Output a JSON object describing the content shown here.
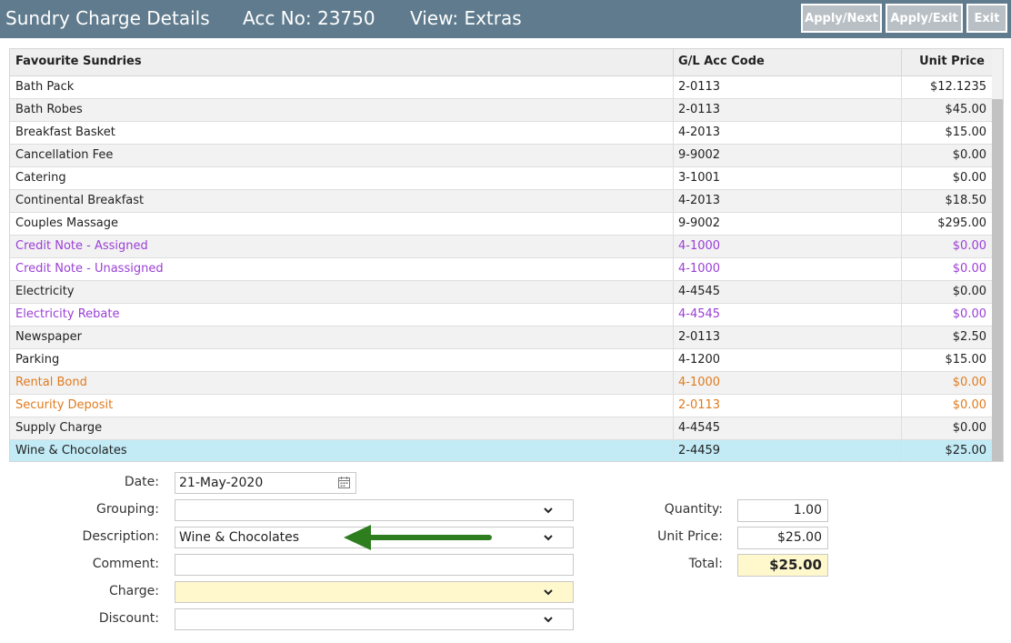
{
  "header": {
    "title": "Sundry Charge Details",
    "acc_no": "Acc No: 23750",
    "view": "View: Extras",
    "buttons": {
      "apply_next": "Apply/Next",
      "apply_exit": "Apply/Exit",
      "exit": "Exit"
    },
    "bg_color": "#5f7b8d"
  },
  "grid": {
    "columns": {
      "name": "Favourite Sundries",
      "gl": "G/L Acc Code",
      "price": "Unit Price"
    },
    "rows": [
      {
        "name": "Bath Pack",
        "gl": "2-0113",
        "price": "$12.1235",
        "style": ""
      },
      {
        "name": "Bath Robes",
        "gl": "2-0113",
        "price": "$45.00",
        "style": ""
      },
      {
        "name": "Breakfast Basket",
        "gl": "4-2013",
        "price": "$15.00",
        "style": ""
      },
      {
        "name": "Cancellation Fee",
        "gl": "9-9002",
        "price": "$0.00",
        "style": ""
      },
      {
        "name": "Catering",
        "gl": "3-1001",
        "price": "$0.00",
        "style": ""
      },
      {
        "name": "Continental Breakfast",
        "gl": "4-2013",
        "price": "$18.50",
        "style": ""
      },
      {
        "name": "Couples Massage",
        "gl": "9-9002",
        "price": "$295.00",
        "style": ""
      },
      {
        "name": "Credit Note - Assigned",
        "gl": "4-1000",
        "price": "$0.00",
        "style": "purple"
      },
      {
        "name": "Credit Note - Unassigned",
        "gl": "4-1000",
        "price": "$0.00",
        "style": "purple"
      },
      {
        "name": "Electricity",
        "gl": "4-4545",
        "price": "$0.00",
        "style": ""
      },
      {
        "name": "Electricity Rebate",
        "gl": "4-4545",
        "price": "$0.00",
        "style": "purple"
      },
      {
        "name": "Newspaper",
        "gl": "2-0113",
        "price": "$2.50",
        "style": ""
      },
      {
        "name": "Parking",
        "gl": "4-1200",
        "price": "$15.00",
        "style": ""
      },
      {
        "name": "Rental Bond",
        "gl": "4-1000",
        "price": "$0.00",
        "style": "orange"
      },
      {
        "name": "Security Deposit",
        "gl": "2-0113",
        "price": "$0.00",
        "style": "orange"
      },
      {
        "name": "Supply Charge",
        "gl": "4-4545",
        "price": "$0.00",
        "style": ""
      },
      {
        "name": "Wine & Chocolates",
        "gl": "2-4459",
        "price": "$25.00",
        "style": "selected"
      }
    ]
  },
  "form": {
    "date_label": "Date:",
    "date_value": "21-May-2020",
    "grouping_label": "Grouping:",
    "grouping_value": "",
    "description_label": "Description:",
    "description_value": "Wine & Chocolates",
    "comment_label": "Comment:",
    "comment_value": "",
    "charge_label": "Charge:",
    "charge_value": "",
    "discount_label": "Discount:",
    "discount_value": "",
    "quantity_label": "Quantity:",
    "quantity_value": "1.00",
    "unit_price_label": "Unit Price:",
    "unit_price_value": "$25.00",
    "total_label": "Total:",
    "total_value": "$25.00"
  },
  "icons": {
    "calendar": "calendar-icon",
    "dropdown": "chevron-down-icon",
    "annotation": "arrow-left-icon"
  },
  "colors": {
    "purple_text": "#9b3fd6",
    "orange_text": "#e07b1e",
    "selected_row": "#c2ebf5",
    "highlight_field": "#fff8cc",
    "annotation_arrow": "#2e7d1e"
  }
}
